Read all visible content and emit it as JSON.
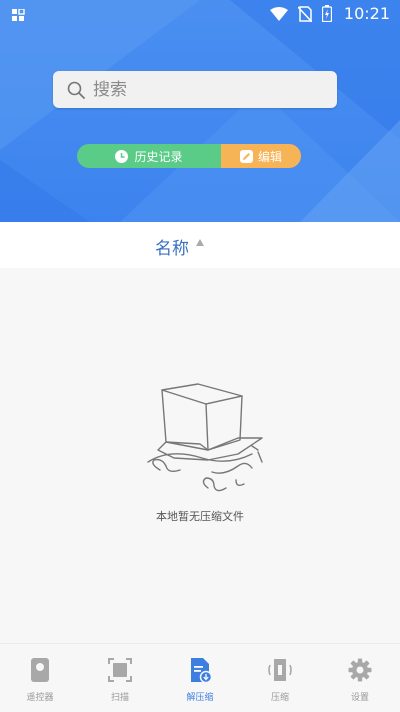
{
  "status_bar": {
    "time": "10:21"
  },
  "search": {
    "placeholder": "搜索"
  },
  "actions": {
    "history_label": "历史记录",
    "edit_label": "编辑"
  },
  "sort": {
    "label": "名称"
  },
  "empty_state": {
    "message": "本地暂无压缩文件"
  },
  "tab_bar": {
    "tabs": [
      {
        "label": "遥控器",
        "icon": "remote-icon",
        "active": false
      },
      {
        "label": "扫描",
        "icon": "scan-icon",
        "active": false
      },
      {
        "label": "解压缩",
        "icon": "unzip-icon",
        "active": true
      },
      {
        "label": "压缩",
        "icon": "compress-icon",
        "active": false
      },
      {
        "label": "设置",
        "icon": "gear-icon",
        "active": false
      }
    ]
  },
  "colors": {
    "header_blue": "#3c83ef",
    "history_green": "#5bcb88",
    "edit_orange": "#f7b457",
    "accent_blue": "#3c7fe0",
    "inactive_gray": "#999999"
  }
}
